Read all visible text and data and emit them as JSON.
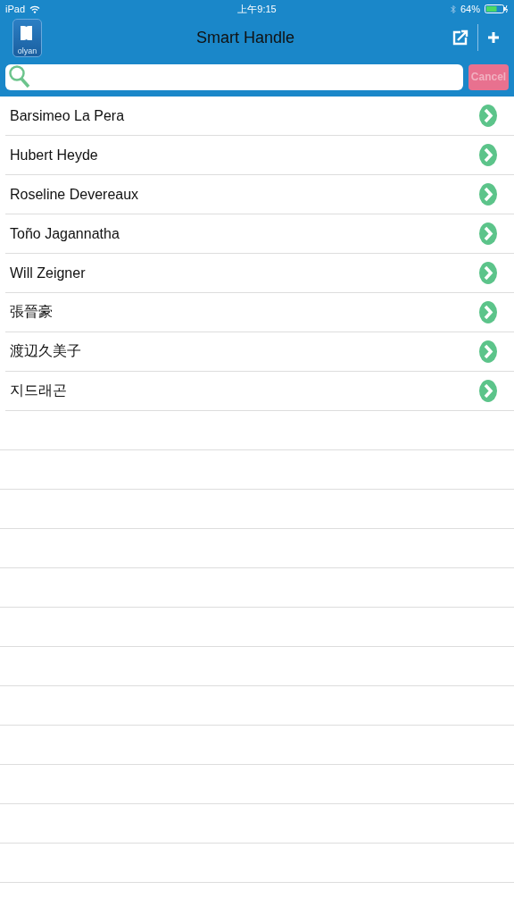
{
  "status_bar": {
    "device": "iPad",
    "time": "上午9:15",
    "battery": "64%"
  },
  "nav_bar": {
    "logo_text": "olyan",
    "title": "Smart Handle"
  },
  "search": {
    "cancel": {
      "label": "Cancel",
      "disabled": true
    }
  },
  "contacts": [
    {
      "name": "Barsimeo La Pera"
    },
    {
      "name": "Hubert Heyde"
    },
    {
      "name": "Roseline Devereaux"
    },
    {
      "name": "Toño Jagannatha"
    },
    {
      "name": "Will Zeigner"
    },
    {
      "name": "張晉豪"
    },
    {
      "name": "渡辺久美子"
    },
    {
      "name": "지드래곤"
    }
  ]
}
